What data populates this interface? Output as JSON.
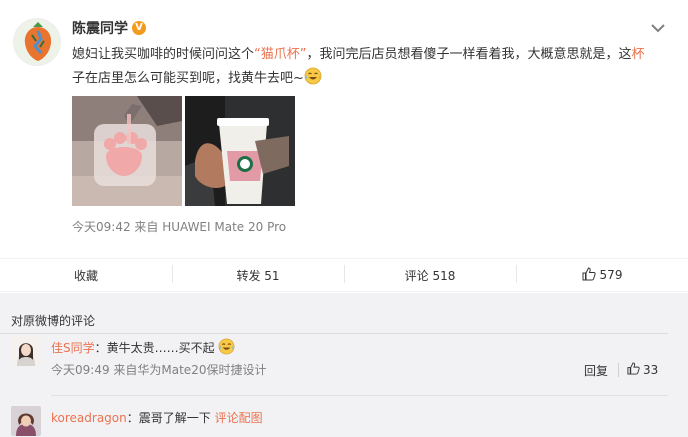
{
  "post": {
    "author": "陈震同学",
    "verified_badge": "V",
    "text_before": "媳妇让我买咖啡的时候问问这个",
    "text_highlight": "“猫爪杯”",
    "text_after": "，我问完后店员想看傻子一样看着我，大概意思就是，这",
    "text_highlight2": "杯",
    "text_end": "子在店里怎么可能买到呢，找黄牛去吧~",
    "emoji": "laughing-tears-emoji",
    "meta": "今天09:42 来自 HUAWEI Mate 20 Pro",
    "menu_icon": "chevron-down-icon"
  },
  "actions": {
    "favorite": "收藏",
    "repost": "转发 51",
    "comment": "评论 518",
    "like": "579"
  },
  "comments_section": {
    "title": "对原微博的评论",
    "items": [
      {
        "user": "佳S同学",
        "separator": "：",
        "text": "黄牛太贵……买不起",
        "emoji": "laughing-tears-emoji",
        "meta": "今天09:49 来自华为Mate20保时捷设计",
        "reply": "回复",
        "likes": "33"
      },
      {
        "user": "koreadragon",
        "separator": "：",
        "text": "震哥了解一下",
        "link": "评论配图"
      }
    ]
  },
  "colors": {
    "accent": "#eb7350",
    "verified": "#f39b1e",
    "meta_gray": "#808080",
    "comment_bg": "#f2f2f5"
  }
}
